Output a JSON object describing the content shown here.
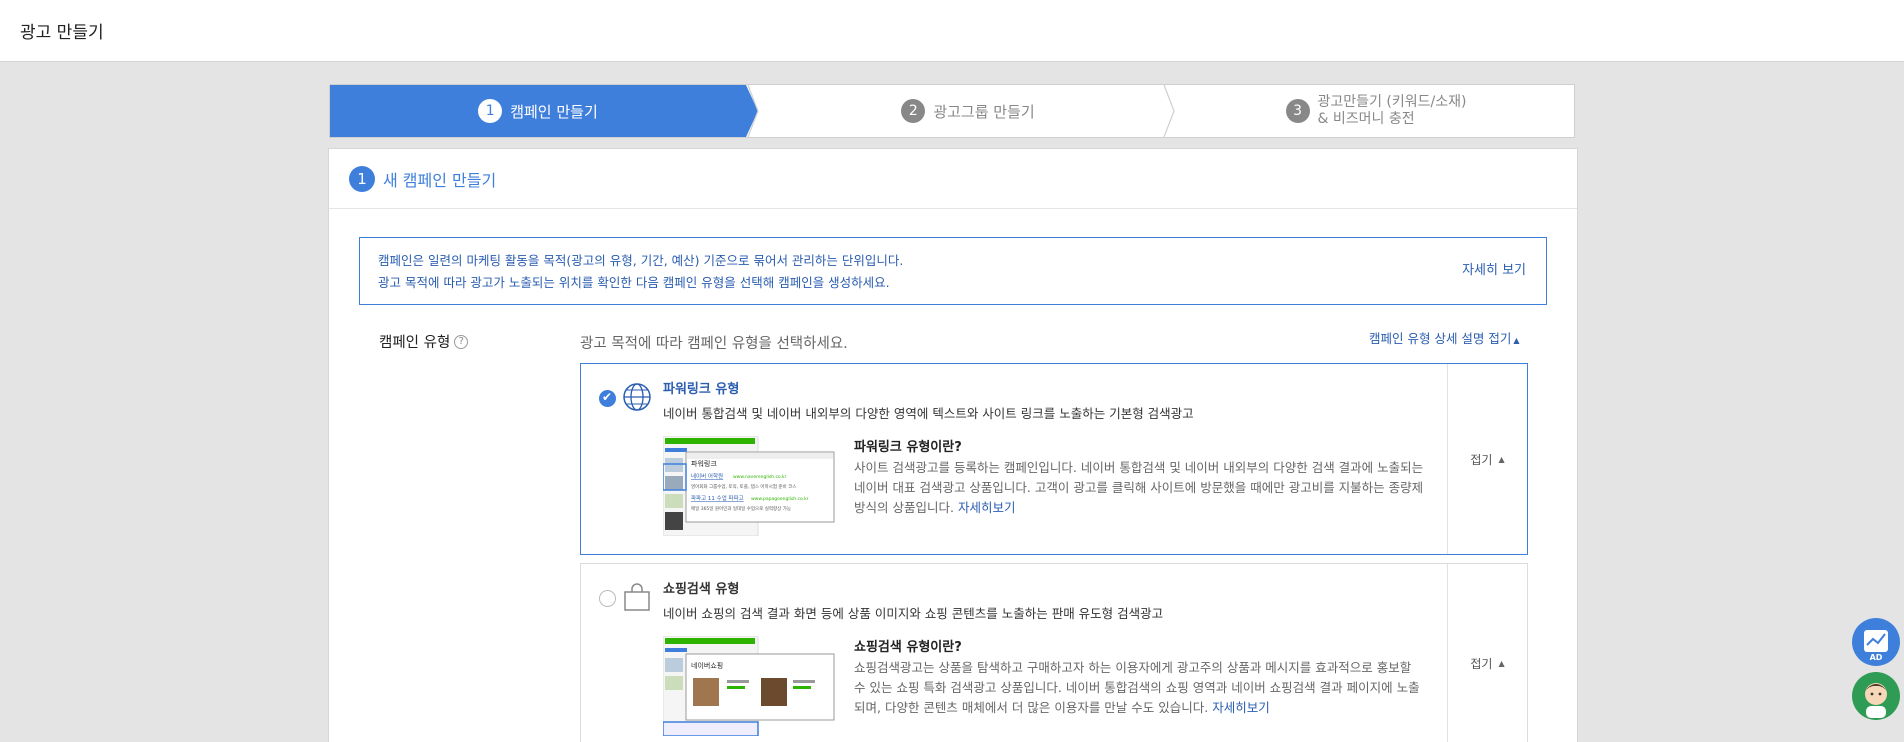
{
  "header": {
    "title": "광고 만들기"
  },
  "steps": [
    {
      "num": "1",
      "label": "캠페인 만들기"
    },
    {
      "num": "2",
      "label": "광고그룹 만들기"
    },
    {
      "num": "3",
      "label_line1": "광고만들기 (키워드/소재)",
      "label_line2": "& 비즈머니 충전"
    }
  ],
  "section": {
    "num": "1",
    "title": "새 캠페인 만들기"
  },
  "info": {
    "line1": "캠페인은 일련의 마케팅 활동을 목적(광고의 유형, 기간, 예산) 기준으로 묶어서 관리하는 단위입니다.",
    "line2": "광고 목적에 따라 광고가 노출되는 위치를 확인한 다음 캠페인 유형을 선택해 캠페인을 생성하세요.",
    "more": "자세히 보기"
  },
  "campaign": {
    "label": "캠페인 유형",
    "help_icon": "?",
    "instruction": "광고 목적에 따라 캠페인 유형을 선택하세요.",
    "detail_toggle": "캠페인 유형 상세 설명 접기",
    "options": [
      {
        "title": "파워링크 유형",
        "desc": "네이버 통합검색 및 네이버 내외부의 다양한 영역에 텍스트와 사이트 링크를 노출하는 기본형 검색광고",
        "sub_title": "파워링크 유형이란?",
        "sub_desc": "사이트 검색광고를 등록하는 캠페인입니다. 네이버 통합검색 및 네이버 내외부의 다양한 검색 결과에 노출되는 네이버 대표 검색광고 상품입니다. 고객이 광고를 클릭해 사이트에 방문했을 때에만 광고비를 지불하는 종량제 방식의 상품입니다.",
        "link": "자세히보기",
        "fold": "접기",
        "icon": "globe-icon",
        "thumb_label": "파워링크",
        "thumb_line1": "네이버 어학원",
        "thumb_url1": "www.naverenglish.co.kr",
        "thumb_line2": "영어회화 그룹수업, 토익, 토플, 텝스 어학시험 준비 코스",
        "thumb_line3": "파파고 11 수업 파파고",
        "thumb_url3": "www.papagoenglish.co.kr",
        "thumb_line4": "매일 365일 원어민과 일대일 수업으로 실력향상 가능"
      },
      {
        "title": "쇼핑검색 유형",
        "desc": "네이버 쇼핑의 검색 결과 화면 등에 상품 이미지와 쇼핑 콘텐츠를 노출하는 판매 유도형 검색광고",
        "sub_title": "쇼핑검색 유형이란?",
        "sub_desc": "쇼핑검색광고는 상품을 탐색하고 구매하고자 하는 이용자에게 광고주의 상품과 메시지를 효과적으로 홍보할 수 있는 쇼핑 특화 검색광고 상품입니다. 네이버 통합검색의 쇼핑 영역과 네이버 쇼핑검색 결과 페이지에 노출되며, 다양한 콘텐츠 매체에서 더 많은 이용자를 만날 수도 있습니다.",
        "link": "자세히보기",
        "fold": "접기",
        "icon": "shopping-bag-icon",
        "thumb_label": "네이버쇼핑"
      }
    ]
  },
  "fab": {
    "ad_label": "AD"
  },
  "colors": {
    "primary": "#3f7fdc",
    "link": "#2a5db0"
  }
}
